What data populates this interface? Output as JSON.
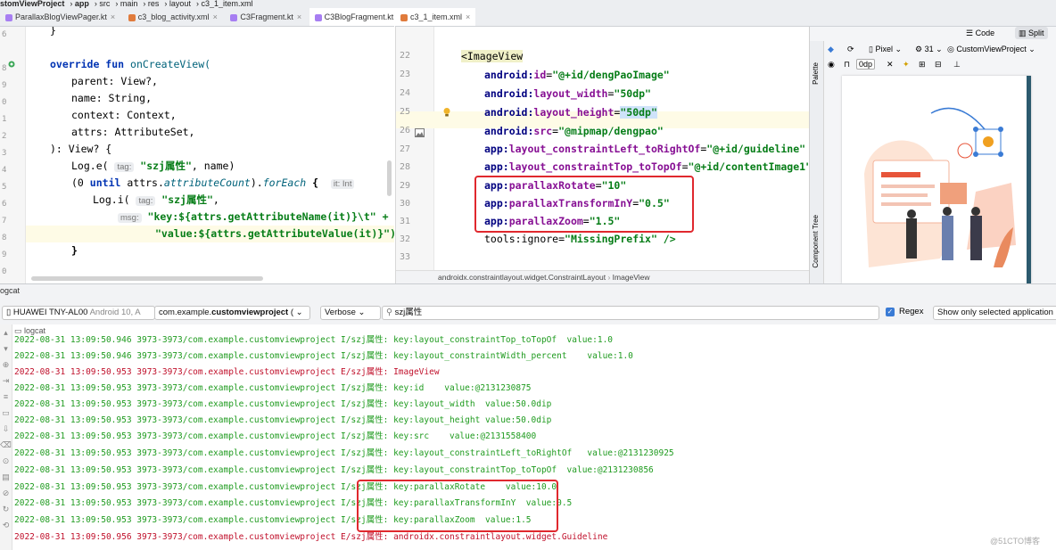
{
  "breadcrumb": [
    "stomViewProject",
    "app",
    "src",
    "main",
    "res",
    "layout",
    "c3_1_item.xml"
  ],
  "left_tabs": [
    {
      "label": "ParallaxBlogViewPager.kt",
      "color": "#a77ef2",
      "active": false
    },
    {
      "label": "c3_blog_activity.xml",
      "color": "#e07b3c",
      "active": false
    },
    {
      "label": "C3Fragment.kt",
      "color": "#a77ef2",
      "active": false
    },
    {
      "label": "C3BlogFragment.kt",
      "color": "#a77ef2",
      "active": true
    }
  ],
  "right_tabs": [
    {
      "label": "c3_1_item.xml",
      "color": "#e07b3c",
      "active": true
    }
  ],
  "left_code": {
    "l1": "}",
    "l3_kw": "override fun",
    "l3_fn": "onCreateView(",
    "l4": "parent: View?,",
    "l5": "name: String,",
    "l6": "context: Context,",
    "l7": "attrs: AttributeSet,",
    "l8": "): View? {",
    "l9a": "Log.e(",
    "l9_hint": "tag:",
    "l9_str": "\"szj属性\"",
    "l9b": ", name)",
    "l10a": "(0",
    "l10_kw": "until",
    "l10b": "attrs.",
    "l10_it1": "attributeCount",
    "l10c": ").",
    "l10_it2": "forEach",
    "l10d": " {",
    "l10_hint": "it: Int",
    "l11a": "Log.i(",
    "l11_hint": "tag:",
    "l11_str": "\"szj属性\"",
    "l11b": ",",
    "l12_hint": "msg:",
    "l12": "\"key:${attrs.getAttributeName(it)}\\t\" +",
    "l13": "\"value:${attrs.getAttributeValue(it)}\")",
    "l14": "}"
  },
  "right_code": {
    "line_numbers": [
      "22",
      "23",
      "24",
      "25",
      "26",
      "27",
      "28",
      "29",
      "30",
      "31",
      "32",
      "33"
    ],
    "tag": "<ImageView",
    "attrs": [
      {
        "ns": "android:",
        "name": "id",
        "value": "\"@+id/dengPaoImage\""
      },
      {
        "ns": "android:",
        "name": "layout_width",
        "value": "\"50dp\""
      },
      {
        "ns": "android:",
        "name": "layout_height",
        "value": "\"50dp\""
      },
      {
        "ns": "android:",
        "name": "src",
        "value": "\"@mipmap/dengpao\""
      },
      {
        "ns": "app:",
        "name": "layout_constraintLeft_toRightOf",
        "value": "\"@+id/guideline\""
      },
      {
        "ns": "app:",
        "name": "layout_constraintTop_toTopOf",
        "value": "\"@+id/contentImage1\""
      },
      {
        "ns": "app:",
        "name": "parallaxRotate",
        "value": "\"10\""
      },
      {
        "ns": "app:",
        "name": "parallaxTransformInY",
        "value": "\"0.5\""
      },
      {
        "ns": "app:",
        "name": "parallaxZoom",
        "value": "\"1.5\""
      },
      {
        "ns": "tools:",
        "name": "ignore",
        "value": "\"MissingPrefix\" />"
      }
    ],
    "status_path": [
      "androidx.constraintlayout.widget.ConstraintLayout",
      "ImageView"
    ]
  },
  "design": {
    "code_label": "Code",
    "split_label": "Split",
    "device": "Pixel",
    "api": "31",
    "project": "CustomViewProject",
    "margin": "0dp",
    "palette_label": "Palette",
    "component_tree_label": "Component Tree"
  },
  "logcat": {
    "title": "ogcat",
    "device": "HUAWEI TNY-AL00",
    "device_os": "Android 10, A",
    "package_prefix": "com.example.",
    "package_bold": "customviewproject",
    "package_suffix": "(",
    "level": "Verbose",
    "search": "szj属性",
    "regex_label": "Regex",
    "filter": "Show only selected application",
    "sub_label": "logcat",
    "lines": [
      {
        "level": "I",
        "text": "2022-08-31 13:09:50.946 3973-3973/com.example.customviewproject I/szj属性: key:layout_constraintTop_toTopOf  value:1.0"
      },
      {
        "level": "I",
        "text": "2022-08-31 13:09:50.946 3973-3973/com.example.customviewproject I/szj属性: key:layout_constraintWidth_percent    value:1.0"
      },
      {
        "level": "E",
        "text": "2022-08-31 13:09:50.953 3973-3973/com.example.customviewproject E/szj属性: ImageView"
      },
      {
        "level": "I",
        "text": "2022-08-31 13:09:50.953 3973-3973/com.example.customviewproject I/szj属性: key:id    value:@2131230875"
      },
      {
        "level": "I",
        "text": "2022-08-31 13:09:50.953 3973-3973/com.example.customviewproject I/szj属性: key:layout_width  value:50.0dip"
      },
      {
        "level": "I",
        "text": "2022-08-31 13:09:50.953 3973-3973/com.example.customviewproject I/szj属性: key:layout_height value:50.0dip"
      },
      {
        "level": "I",
        "text": "2022-08-31 13:09:50.953 3973-3973/com.example.customviewproject I/szj属性: key:src    value:@2131558400"
      },
      {
        "level": "I",
        "text": "2022-08-31 13:09:50.953 3973-3973/com.example.customviewproject I/szj属性: key:layout_constraintLeft_toRightOf   value:@2131230925"
      },
      {
        "level": "I",
        "text": "2022-08-31 13:09:50.953 3973-3973/com.example.customviewproject I/szj属性: key:layout_constraintTop_toTopOf  value:@2131230856"
      },
      {
        "level": "I",
        "text": "2022-08-31 13:09:50.953 3973-3973/com.example.customviewproject I/szj属性: key:parallaxRotate    value:10.0"
      },
      {
        "level": "I",
        "text": "2022-08-31 13:09:50.953 3973-3973/com.example.customviewproject I/szj属性: key:parallaxTransformInY  value:0.5"
      },
      {
        "level": "I",
        "text": "2022-08-31 13:09:50.953 3973-3973/com.example.customviewproject I/szj属性: key:parallaxZoom  value:1.5"
      },
      {
        "level": "E",
        "text": "2022-08-31 13:09:50.956 3973-3973/com.example.customviewproject E/szj属性: androidx.constraintlayout.widget.Guideline"
      }
    ]
  },
  "watermark": "@51CTO博客"
}
